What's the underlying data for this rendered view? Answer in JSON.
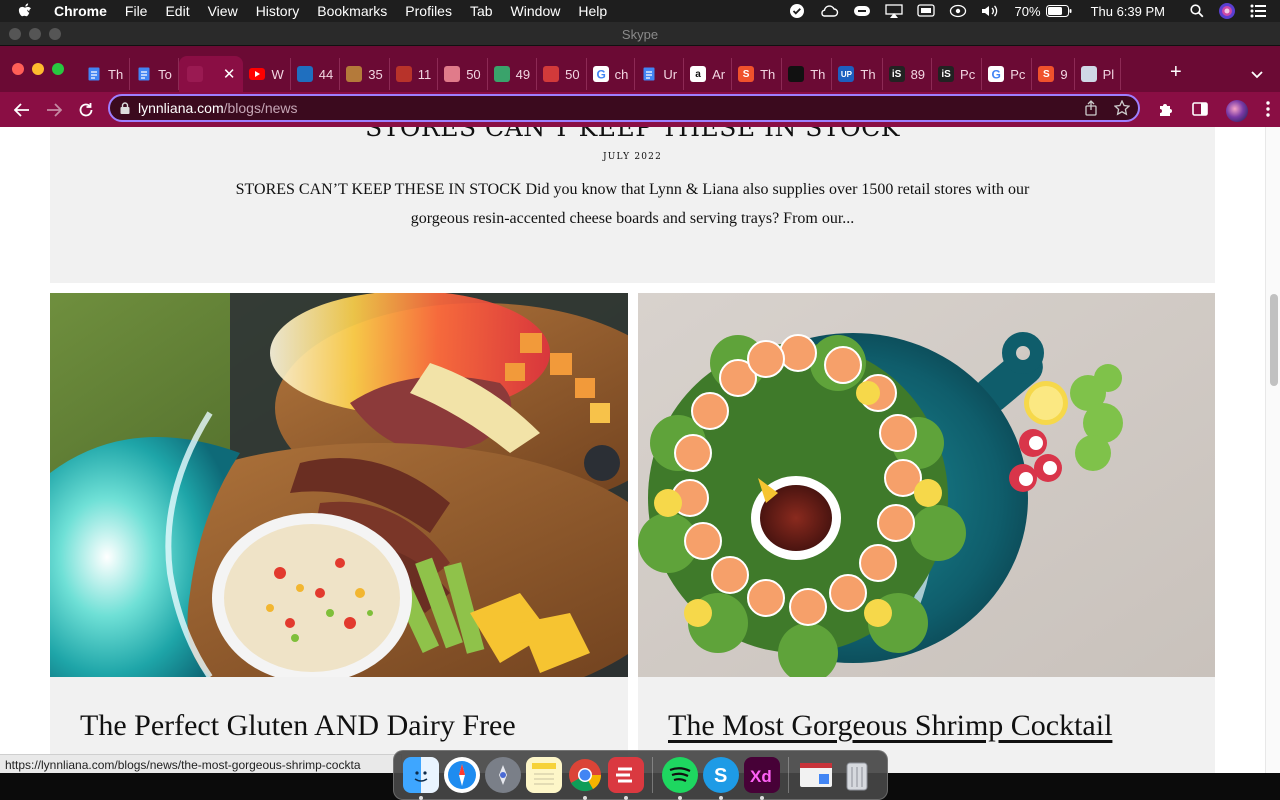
{
  "menubar": {
    "app_name": "Chrome",
    "items": [
      "File",
      "Edit",
      "View",
      "History",
      "Bookmarks",
      "Profiles",
      "Tab",
      "Window",
      "Help"
    ],
    "battery": "70%",
    "clock": "Thu 6:39 PM"
  },
  "window": {
    "title": "Skype"
  },
  "tabs": [
    {
      "label": "Th",
      "favicon": "docs-icon",
      "color": "#4285f4"
    },
    {
      "label": "To",
      "favicon": "docs-icon",
      "color": "#4285f4"
    },
    {
      "label": "",
      "favicon": "site-icon",
      "color": "#9a1a52",
      "active": true
    },
    {
      "label": "W",
      "favicon": "youtube-icon",
      "color": "#ff0000"
    },
    {
      "label": "44",
      "favicon": "site-icon",
      "color": "#1f6fbf"
    },
    {
      "label": "35",
      "favicon": "site-icon",
      "color": "#b47a3a"
    },
    {
      "label": "11",
      "favicon": "site-icon",
      "color": "#b8332a"
    },
    {
      "label": "50",
      "favicon": "site-icon",
      "color": "#e07b8a"
    },
    {
      "label": "49",
      "favicon": "site-icon",
      "color": "#3aa36b"
    },
    {
      "label": "50",
      "favicon": "site-icon",
      "color": "#d23a3a"
    },
    {
      "label": "ch",
      "favicon": "google-icon",
      "color": "#ffffff"
    },
    {
      "label": "Ur",
      "favicon": "docs-icon",
      "color": "#4285f4"
    },
    {
      "label": "Ar",
      "favicon": "amazon-icon",
      "color": "#222222"
    },
    {
      "label": "Th",
      "favicon": "s-icon",
      "color": "#f0522c"
    },
    {
      "label": "Th",
      "favicon": "site-icon",
      "color": "#111111"
    },
    {
      "label": "Th",
      "favicon": "up-icon",
      "color": "#1d5fbf"
    },
    {
      "label": "89",
      "favicon": "is-icon",
      "color": "#222222"
    },
    {
      "label": "Pc",
      "favicon": "is-icon",
      "color": "#222222"
    },
    {
      "label": "Pc",
      "favicon": "google-icon",
      "color": "#ffffff"
    },
    {
      "label": "9",
      "favicon": "s-icon",
      "color": "#f0522c"
    },
    {
      "label": "Pl",
      "favicon": "site-icon",
      "color": "#cfd8e6"
    }
  ],
  "omnibox": {
    "host": "lynnliana.com",
    "path": "/blogs/news"
  },
  "feature": {
    "title": "STORES CAN'T KEEP THESE IN STOCK",
    "date": "JULY 2022",
    "excerpt": "STORES CAN’T KEEP THESE IN STOCK Did you know that Lynn & Liana also supplies over 1500 retail stores with our gorgeous resin-accented cheese boards and serving trays? From our..."
  },
  "posts": [
    {
      "title": "The Perfect Gluten AND Dairy Free"
    },
    {
      "title": "The Most Gorgeous Shrimp Cocktail"
    }
  ],
  "status_url": "https://lynnliana.com/blogs/news/the-most-gorgeous-shrimp-cockta",
  "dock": [
    "finder",
    "safari",
    "launchpad",
    "notes",
    "chrome",
    "expressvpn",
    "spotify",
    "skype",
    "adobe-xd",
    "preview",
    "trash"
  ]
}
